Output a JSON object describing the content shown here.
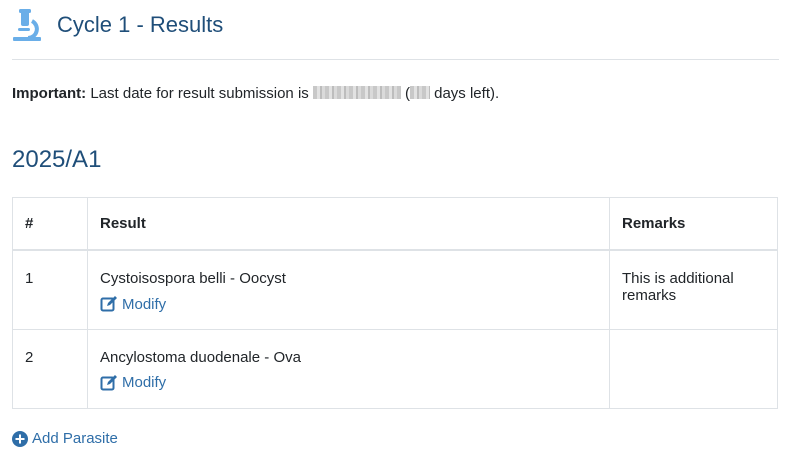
{
  "header": {
    "title": "Cycle 1 - Results",
    "icon": "microscope-icon"
  },
  "notice": {
    "label": "Important:",
    "text_before": "Last date for result submission is",
    "text_paren_open": " (",
    "text_after": " days left)."
  },
  "section": {
    "title": "2025/A1"
  },
  "table": {
    "headers": {
      "num": "#",
      "result": "Result",
      "remarks": "Remarks"
    },
    "rows": [
      {
        "num": "1",
        "result": "Cystoisospora belli - Oocyst",
        "modify_label": "Modify",
        "remarks": "This is additional remarks"
      },
      {
        "num": "2",
        "result": "Ancylostoma duodenale - Ova",
        "modify_label": "Modify",
        "remarks": ""
      }
    ]
  },
  "add_button": {
    "label": "Add Parasite"
  },
  "colors": {
    "title": "#1f4e79",
    "link": "#2f6ea8",
    "icon": "#6aaee8"
  }
}
